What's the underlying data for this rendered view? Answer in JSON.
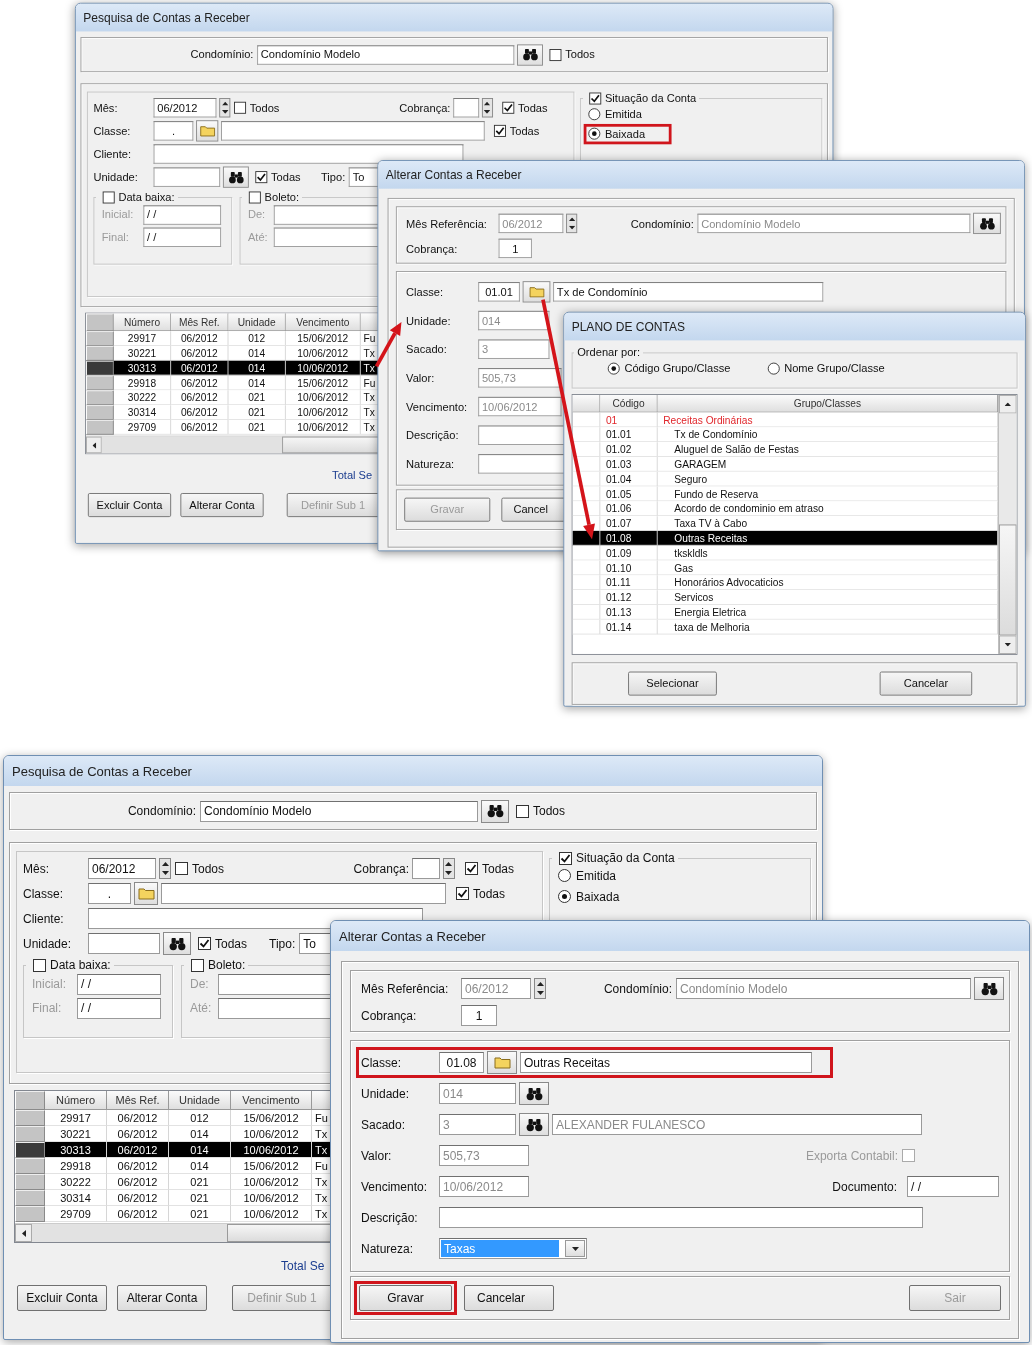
{
  "screens": [
    {
      "search_window": {
        "title": "Pesquisa de Contas a Receber",
        "condominio": {
          "label": "Condomínio:",
          "value": "Condomínio Modelo",
          "all_label": "Todos",
          "all_checked": false
        },
        "filters": {
          "mes": {
            "label": "Mês:",
            "value": "06/2012",
            "all_label": "Todos",
            "all_checked": false
          },
          "cobranca": {
            "label": "Cobrança:",
            "all_label": "Todas",
            "all_checked": true
          },
          "classe": {
            "label": "Classe:",
            "value": ".",
            "all_label": "Todas",
            "all_checked": true
          },
          "cliente": {
            "label": "Cliente:"
          },
          "unidade": {
            "label": "Unidade:",
            "all_label": "Todas",
            "all_checked": true
          },
          "tipo": {
            "label": "Tipo:",
            "value": "To"
          },
          "data_baixa": {
            "label": "Data baixa:",
            "checked": false,
            "inicial_label": "Inicial:",
            "inicial": "/ /",
            "final_label": "Final:",
            "final": "/ /"
          },
          "boleto": {
            "label": "Boleto:",
            "checked": false,
            "de_label": "De:",
            "ate_label": "Até:"
          }
        },
        "situacao": {
          "label": "Situação da Conta",
          "checked": true,
          "options": [
            {
              "label": "Emitida",
              "selected": false
            },
            {
              "label": "Baixada",
              "selected": true,
              "highlighted": true
            }
          ]
        },
        "table": {
          "columns": [
            "Número",
            "Mês Ref.",
            "Unidade",
            "Vencimento"
          ],
          "rows": [
            {
              "cells": [
                "29917",
                "06/2012",
                "012",
                "15/06/2012",
                "Fu"
              ],
              "selected": false
            },
            {
              "cells": [
                "30221",
                "06/2012",
                "014",
                "10/06/2012",
                "Tx"
              ],
              "selected": false
            },
            {
              "cells": [
                "30313",
                "06/2012",
                "014",
                "10/06/2012",
                "Tx"
              ],
              "selected": true
            },
            {
              "cells": [
                "29918",
                "06/2012",
                "014",
                "15/06/2012",
                "Fu"
              ],
              "selected": false
            },
            {
              "cells": [
                "30222",
                "06/2012",
                "021",
                "10/06/2012",
                "Tx"
              ],
              "selected": false
            },
            {
              "cells": [
                "30314",
                "06/2012",
                "021",
                "10/06/2012",
                "Tx"
              ],
              "selected": false
            },
            {
              "cells": [
                "29709",
                "06/2012",
                "021",
                "10/06/2012",
                "Tx"
              ],
              "selected": false
            }
          ]
        },
        "total_label": "Total Se",
        "buttons": [
          {
            "label": "Excluir Conta",
            "disabled": false
          },
          {
            "label": "Alterar Conta",
            "disabled": false
          },
          {
            "label": "Definir Sub 1",
            "disabled": true
          }
        ]
      },
      "edit_window": {
        "title": "Alterar Contas a Receber",
        "mes_ref": {
          "label": "Mês Referência:",
          "value": "06/2012",
          "disabled": true
        },
        "condominio": {
          "label": "Condomínio:",
          "value": "Condomínio Modelo",
          "disabled": true,
          "lookup": true
        },
        "cobranca": {
          "label": "Cobrança:",
          "value": "1"
        },
        "classe": {
          "label": "Classe:",
          "code": "01.01",
          "name": "Tx de Condomínio"
        },
        "unidade": {
          "label": "Unidade:",
          "value": "014",
          "disabled": true
        },
        "sacado": {
          "label": "Sacado:",
          "value": "3",
          "disabled": true
        },
        "valor": {
          "label": "Valor:",
          "value": "505,73",
          "disabled": true
        },
        "vencimento": {
          "label": "Vencimento:",
          "value": "10/06/2012",
          "disabled": true
        },
        "descricao": {
          "label": "Descrição:"
        },
        "natureza": {
          "label": "Natureza:"
        },
        "buttons": [
          {
            "label": "Gravar",
            "disabled": true
          },
          {
            "label": "Cancel",
            "disabled": false
          }
        ]
      },
      "account_plan": {
        "title": "PLANO DE CONTAS",
        "order": {
          "label": "Ordenar por:",
          "options": [
            {
              "label": "Código Grupo/Classe",
              "selected": true
            },
            {
              "label": "Nome Grupo/Classe",
              "selected": false
            }
          ]
        },
        "columns": [
          "Código",
          "Grupo/Classes"
        ],
        "tree": [
          {
            "code": "01",
            "name": "Receitas Ordinárias",
            "selected": false,
            "children": [
              {
                "code": "01.01",
                "name": "Tx de Condomínio",
                "selected": false
              },
              {
                "code": "01.02",
                "name": "Aluguel de Salão de Festas",
                "selected": false
              },
              {
                "code": "01.03",
                "name": "GARAGEM",
                "selected": false
              },
              {
                "code": "01.04",
                "name": "Seguro",
                "selected": false
              },
              {
                "code": "01.05",
                "name": "Fundo de Reserva",
                "selected": false
              },
              {
                "code": "01.06",
                "name": "Acordo de condominio em atraso",
                "selected": false
              },
              {
                "code": "01.07",
                "name": "Taxa TV à Cabo",
                "selected": false
              },
              {
                "code": "01.08",
                "name": "Outras Receitas",
                "selected": true
              },
              {
                "code": "01.09",
                "name": "tkskldls",
                "selected": false
              },
              {
                "code": "01.10",
                "name": "Gas",
                "selected": false
              },
              {
                "code": "01.11",
                "name": "Honorários Advocaticios",
                "selected": false
              },
              {
                "code": "01.12",
                "name": "Servicos",
                "selected": false
              },
              {
                "code": "01.13",
                "name": "Energia Eletrica",
                "selected": false
              },
              {
                "code": "01.14",
                "name": "taxa de Melhoria",
                "selected": false
              }
            ]
          }
        ],
        "buttons": [
          "Selecionar",
          "Cancelar"
        ]
      }
    },
    {
      "search_window": {
        "title": "Pesquisa de Contas a Receber",
        "condominio": {
          "label": "Condomínio:",
          "value": "Condomínio Modelo",
          "all_label": "Todos",
          "all_checked": false
        },
        "filters": {
          "mes": {
            "label": "Mês:",
            "value": "06/2012",
            "all_label": "Todos",
            "all_checked": false
          },
          "cobranca": {
            "label": "Cobrança:",
            "all_label": "Todas",
            "all_checked": true
          },
          "classe": {
            "label": "Classe:",
            "value": ".",
            "all_label": "Todas",
            "all_checked": true
          },
          "cliente": {
            "label": "Cliente:"
          },
          "unidade": {
            "label": "Unidade:",
            "all_label": "Todas",
            "all_checked": true
          },
          "tipo": {
            "label": "Tipo:",
            "value": "To"
          },
          "data_baixa": {
            "label": "Data baixa:",
            "checked": false,
            "inicial_label": "Inicial:",
            "inicial": "/ /",
            "final_label": "Final:",
            "final": "/ /"
          },
          "boleto": {
            "label": "Boleto:",
            "checked": false,
            "de_label": "De:",
            "ate_label": "Até:"
          }
        },
        "situacao": {
          "label": "Situação da Conta",
          "checked": true,
          "options": [
            {
              "label": "Emitida",
              "selected": false
            },
            {
              "label": "Baixada",
              "selected": true
            }
          ]
        },
        "table": {
          "columns": [
            "Número",
            "Mês Ref.",
            "Unidade",
            "Vencimento"
          ],
          "rows": [
            {
              "cells": [
                "29917",
                "06/2012",
                "012",
                "15/06/2012",
                "Fu"
              ],
              "selected": false
            },
            {
              "cells": [
                "30221",
                "06/2012",
                "014",
                "10/06/2012",
                "Tx"
              ],
              "selected": false
            },
            {
              "cells": [
                "30313",
                "06/2012",
                "014",
                "10/06/2012",
                "Tx"
              ],
              "selected": true
            },
            {
              "cells": [
                "29918",
                "06/2012",
                "014",
                "15/06/2012",
                "Fu"
              ],
              "selected": false
            },
            {
              "cells": [
                "30222",
                "06/2012",
                "021",
                "10/06/2012",
                "Tx"
              ],
              "selected": false
            },
            {
              "cells": [
                "30314",
                "06/2012",
                "021",
                "10/06/2012",
                "Tx"
              ],
              "selected": false
            },
            {
              "cells": [
                "29709",
                "06/2012",
                "021",
                "10/06/2012",
                "Tx"
              ],
              "selected": false
            }
          ]
        },
        "total_label": "Total Se",
        "buttons": [
          {
            "label": "Excluir Conta",
            "disabled": false
          },
          {
            "label": "Alterar Conta",
            "disabled": false
          },
          {
            "label": "Definir Sub 1",
            "disabled": true
          }
        ]
      },
      "edit_window": {
        "title": "Alterar Contas a Receber",
        "mes_ref": {
          "label": "Mês Referência:",
          "value": "06/2012",
          "disabled": true
        },
        "condominio": {
          "label": "Condomínio:",
          "value": "Condomínio Modelo",
          "disabled": true,
          "lookup": true
        },
        "cobranca": {
          "label": "Cobrança:",
          "value": "1"
        },
        "classe": {
          "label": "Classe:",
          "code": "01.08",
          "name": "Outras Receitas",
          "highlighted": true
        },
        "unidade": {
          "label": "Unidade:",
          "value": "014",
          "disabled": true,
          "lookup": true
        },
        "sacado": {
          "label": "Sacado:",
          "value": "3",
          "disabled": true,
          "lookup": true,
          "name": "ALEXANDER FULANESCO"
        },
        "valor": {
          "label": "Valor:",
          "value": "505,73",
          "disabled": true
        },
        "exporta": {
          "label": "Exporta Contabil:",
          "checked": false,
          "disabled": true
        },
        "vencimento": {
          "label": "Vencimento:",
          "value": "10/06/2012",
          "disabled": true
        },
        "documento": {
          "label": "Documento:",
          "value": "/ /"
        },
        "descricao": {
          "label": "Descrição:"
        },
        "natureza": {
          "label": "Natureza:",
          "value": "Taxas",
          "value_selected": true,
          "dropdown": true
        },
        "buttons": [
          {
            "label": "Gravar",
            "disabled": false,
            "highlighted": true
          },
          {
            "label": "Cancelar",
            "disabled": false
          },
          {
            "label": "Sair",
            "disabled": true
          }
        ]
      }
    }
  ]
}
